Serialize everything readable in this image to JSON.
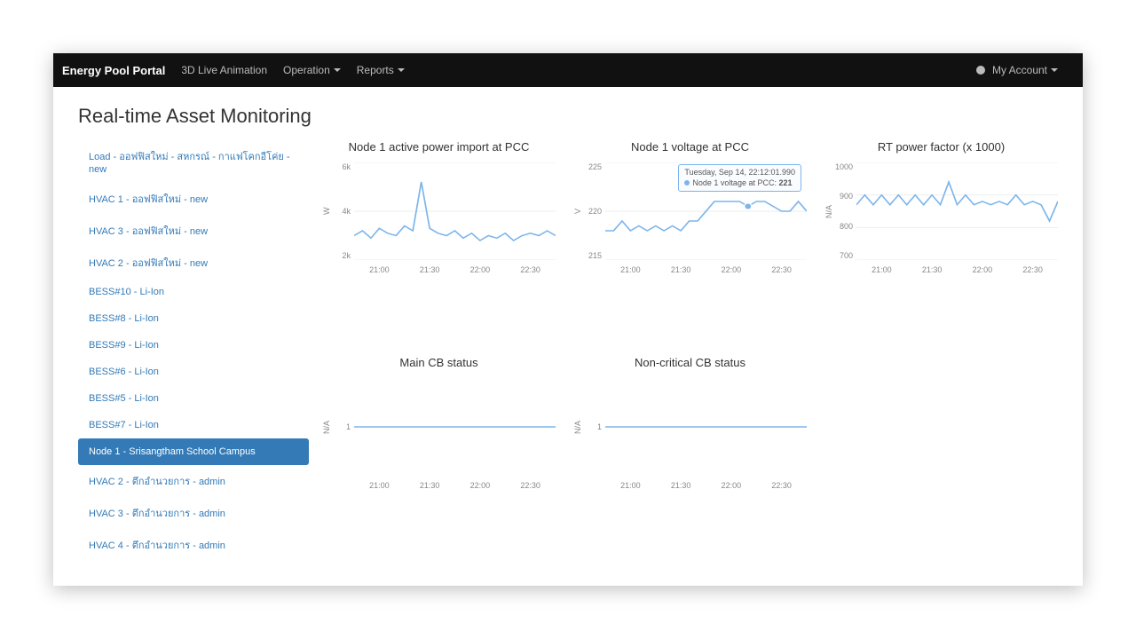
{
  "navbar": {
    "brand": "Energy Pool Portal",
    "items": [
      {
        "label": "3D Live Animation",
        "dropdown": false
      },
      {
        "label": "Operation",
        "dropdown": true
      },
      {
        "label": "Reports",
        "dropdown": true
      }
    ],
    "account_label": "My Account"
  },
  "page": {
    "title": "Real-time Asset Monitoring"
  },
  "sidebar": {
    "items": [
      {
        "label": "Load - ออฟฟิสใหม่ - สหกรณ์ - กาแฟโคกอีโค่ย - new",
        "active": false
      },
      {
        "label": "HVAC 1 - ออฟฟิสใหม่ - new",
        "active": false
      },
      {
        "label": "HVAC 3 - ออฟฟิสใหม่ - new",
        "active": false
      },
      {
        "label": "HVAC 2 - ออฟฟิสใหม่ - new",
        "active": false
      },
      {
        "label": "BESS#10 - Li-Ion",
        "active": false
      },
      {
        "label": "BESS#8 - Li-Ion",
        "active": false
      },
      {
        "label": "BESS#9 - Li-Ion",
        "active": false
      },
      {
        "label": "BESS#6 - Li-Ion",
        "active": false
      },
      {
        "label": "BESS#5 - Li-Ion",
        "active": false
      },
      {
        "label": "BESS#7 - Li-Ion",
        "active": false
      },
      {
        "label": "Node 1 - Srisangtham School Campus",
        "active": true
      },
      {
        "label": "HVAC 2 - ตึกอำนวยการ - admin",
        "active": false
      },
      {
        "label": "HVAC 3 - ตึกอำนวยการ - admin",
        "active": false
      },
      {
        "label": "HVAC 4 - ตึกอำนวยการ - admin",
        "active": false
      }
    ]
  },
  "chart_data": [
    {
      "id": "active-power",
      "title": "Node 1 active power import at PCC",
      "type": "line",
      "ylabel": "W",
      "yticks": [
        "6k",
        "4k",
        "2k"
      ],
      "ylim": [
        2000,
        6000
      ],
      "xticks": [
        "21:00",
        "21:30",
        "22:00",
        "22:30"
      ],
      "x": [
        "20:45",
        "20:50",
        "20:55",
        "21:00",
        "21:05",
        "21:10",
        "21:15",
        "21:20",
        "21:25",
        "21:30",
        "21:35",
        "21:40",
        "21:45",
        "21:50",
        "21:55",
        "22:00",
        "22:05",
        "22:10",
        "22:15",
        "22:20",
        "22:25",
        "22:30",
        "22:35",
        "22:40",
        "22:45"
      ],
      "values": [
        3000,
        3200,
        2900,
        3300,
        3100,
        3000,
        3400,
        3200,
        5200,
        3300,
        3100,
        3000,
        3200,
        2900,
        3100,
        2800,
        3000,
        2900,
        3100,
        2800,
        3000,
        3100,
        3000,
        3200,
        3000
      ]
    },
    {
      "id": "voltage",
      "title": "Node 1 voltage at PCC",
      "type": "line",
      "ylabel": "V",
      "yticks": [
        "225",
        "220",
        "215"
      ],
      "ylim": [
        215,
        225
      ],
      "xticks": [
        "21:00",
        "21:30",
        "22:00",
        "22:30"
      ],
      "x": [
        "20:45",
        "20:50",
        "20:55",
        "21:00",
        "21:05",
        "21:10",
        "21:15",
        "21:20",
        "21:25",
        "21:30",
        "21:35",
        "21:40",
        "21:45",
        "21:50",
        "21:55",
        "22:00",
        "22:05",
        "22:10",
        "22:15",
        "22:20",
        "22:25",
        "22:30",
        "22:35",
        "22:40",
        "22:45"
      ],
      "values": [
        218,
        218,
        219,
        218,
        218.5,
        218,
        218.5,
        218,
        218.5,
        218,
        219,
        219,
        220,
        221,
        221,
        221,
        221,
        220.5,
        221,
        221,
        220.5,
        220,
        220,
        221,
        220
      ],
      "tooltip": {
        "line1": "Tuesday, Sep 14, 22:12:01.990",
        "series": "Node 1 voltage at PCC",
        "value": "221",
        "marker_index": 17
      }
    },
    {
      "id": "power-factor",
      "title": "RT power factor (x 1000)",
      "type": "line",
      "ylabel": "N/A",
      "yticks": [
        "1000",
        "900",
        "800",
        "700"
      ],
      "ylim": [
        700,
        1000
      ],
      "xticks": [
        "21:00",
        "21:30",
        "22:00",
        "22:30"
      ],
      "x": [
        "20:45",
        "20:50",
        "20:55",
        "21:00",
        "21:05",
        "21:10",
        "21:15",
        "21:20",
        "21:25",
        "21:30",
        "21:35",
        "21:40",
        "21:45",
        "21:50",
        "21:55",
        "22:00",
        "22:05",
        "22:10",
        "22:15",
        "22:20",
        "22:25",
        "22:30",
        "22:35",
        "22:40",
        "22:45"
      ],
      "values": [
        870,
        900,
        870,
        900,
        870,
        900,
        870,
        900,
        870,
        900,
        870,
        940,
        870,
        900,
        870,
        880,
        870,
        880,
        870,
        900,
        870,
        880,
        870,
        820,
        880
      ]
    },
    {
      "id": "main-cb",
      "title": "Main CB status",
      "type": "line",
      "ylabel": "N/A",
      "yticks": [
        "1"
      ],
      "ylim": [
        0,
        2
      ],
      "xticks": [
        "21:00",
        "21:30",
        "22:00",
        "22:30"
      ],
      "x": [
        "20:45",
        "22:45"
      ],
      "values": [
        1,
        1
      ]
    },
    {
      "id": "noncrit-cb",
      "title": "Non-critical CB status",
      "type": "line",
      "ylabel": "N/A",
      "yticks": [
        "1"
      ],
      "ylim": [
        0,
        2
      ],
      "xticks": [
        "21:00",
        "21:30",
        "22:00",
        "22:30"
      ],
      "x": [
        "20:45",
        "22:45"
      ],
      "values": [
        1,
        1
      ]
    }
  ]
}
